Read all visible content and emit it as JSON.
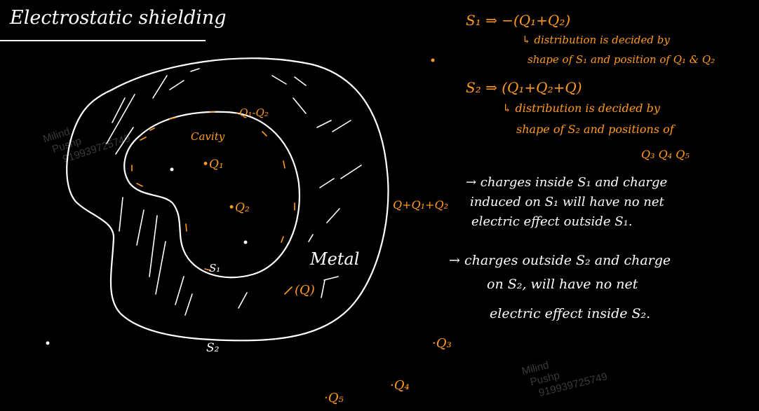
{
  "title": "Electrostatic shielding",
  "labels": {
    "cavity": "Cavity",
    "s1_induced": "-Q₁-Q₂",
    "q1": "Q₁",
    "q2": "Q₂",
    "s1": "S₁",
    "s2": "S₂",
    "metal": "Metal",
    "metal_charge": "(Q)",
    "outer_induced": "Q+Q₁+Q₂",
    "q3": "Q₃",
    "q4": "Q₄",
    "q5": "Q₅"
  },
  "notes": {
    "s1_line": "S₁ ⇒ −(Q₁+Q₂)",
    "s1_detail_1": "↳ distribution is decided by",
    "s1_detail_2": "shape of S₁ and position of Q₁ & Q₂",
    "s2_line": "S₂ ⇒ (Q₁+Q₂+Q)",
    "s2_detail_1": "↳ distribution is decided by",
    "s2_detail_2": "shape of S₂ and positions of",
    "s2_detail_3": "Q₃ Q₄ Q₅",
    "point1_1": "→ charges inside S₁ and charge",
    "point1_2": "induced on S₁ will have no net",
    "point1_3": "electric effect outside S₁.",
    "point2_1": "→ charges outside S₂ and charge",
    "point2_2": "on S₂, will have no net",
    "point2_3": "electric effect inside S₂."
  },
  "watermark": {
    "line1": "Milind",
    "line2": "Pushp",
    "line3": "919939725749"
  },
  "colors": {
    "background": "#000000",
    "ink": "#ffffff",
    "highlight": "#ff9a1f"
  }
}
